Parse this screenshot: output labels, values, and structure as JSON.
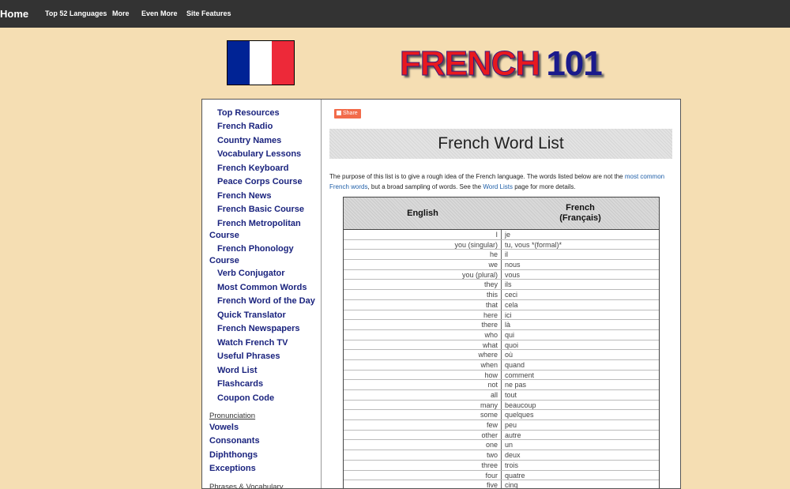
{
  "topnav": {
    "home": "Home",
    "links": [
      "Top 52 Languages",
      "More",
      "Even More",
      "Site Features"
    ]
  },
  "flag": {
    "colors": [
      "#002395",
      "#ffffff",
      "#ed2939"
    ]
  },
  "logo": {
    "part1": "FRENCH",
    "part2": "101"
  },
  "sidebar": {
    "items": [
      "Top Resources",
      "French Radio",
      "Country Names",
      "Vocabulary Lessons",
      "French Keyboard",
      "Peace Corps Course",
      "French News",
      "French Basic Course",
      "French Metropolitan Course",
      "French Phonology Course",
      "Verb Conjugator",
      "Most Common Words",
      "French Word of the Day",
      "Quick Translator",
      "French Newspapers",
      "Watch French TV",
      "Useful Phrases",
      "Word List",
      "Flashcards",
      "Coupon Code"
    ],
    "section1": "Pronunciation",
    "section1_items": [
      "Vowels",
      "Consonants",
      "Diphthongs",
      "Exceptions"
    ],
    "section2": "Phrases & Vocabulary"
  },
  "share": "Share",
  "heading": "French Word List",
  "intro": {
    "part1": "The purpose of this list is to give a rough idea of the French language. The words listed below are not the",
    "link1": "most common French words",
    "part2": ", but a broad sampling of words. See the",
    "link2": "Word Lists",
    "part3": "page for more details."
  },
  "table": {
    "col1": "English",
    "col2_line1": "French",
    "col2_line2": "(Français)",
    "rows": [
      [
        "I",
        "je"
      ],
      [
        "you (singular)",
        "tu, vous *(formal)*"
      ],
      [
        "he",
        "il"
      ],
      [
        "we",
        "nous"
      ],
      [
        "you (plural)",
        "vous"
      ],
      [
        "they",
        "ils"
      ],
      [
        "this",
        "ceci"
      ],
      [
        "that",
        "cela"
      ],
      [
        "here",
        "ici"
      ],
      [
        "there",
        "là"
      ],
      [
        "who",
        "qui"
      ],
      [
        "what",
        "quoi"
      ],
      [
        "where",
        "où"
      ],
      [
        "when",
        "quand"
      ],
      [
        "how",
        "comment"
      ],
      [
        "not",
        "ne pas"
      ],
      [
        "all",
        "tout"
      ],
      [
        "many",
        "beaucoup"
      ],
      [
        "some",
        "quelques"
      ],
      [
        "few",
        "peu"
      ],
      [
        "other",
        "autre"
      ],
      [
        "one",
        "un"
      ],
      [
        "two",
        "deux"
      ],
      [
        "three",
        "trois"
      ],
      [
        "four",
        "quatre"
      ],
      [
        "five",
        "cinq"
      ]
    ]
  }
}
